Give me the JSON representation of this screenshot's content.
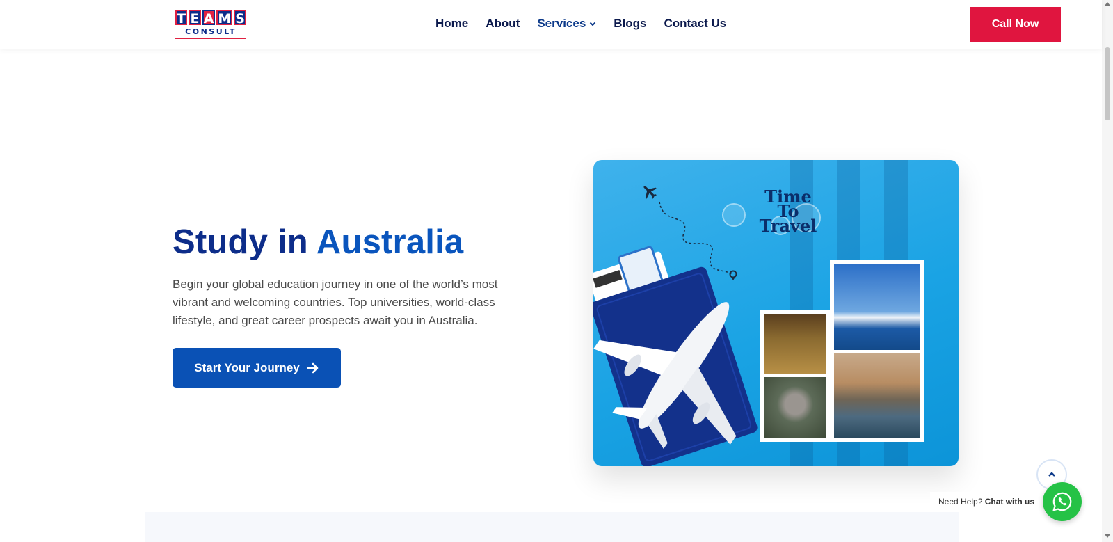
{
  "logo": {
    "letters": [
      "T",
      "E",
      "A",
      "M",
      "S"
    ],
    "sub": "CONSULT"
  },
  "nav": {
    "items": [
      {
        "label": "Home"
      },
      {
        "label": "About"
      },
      {
        "label": "Services"
      },
      {
        "label": "Blogs"
      },
      {
        "label": "Contact Us"
      }
    ]
  },
  "header": {
    "call_label": "Call Now"
  },
  "hero": {
    "title_main": "Study in",
    "title_accent": "Australia",
    "description": "Begin your global education journey in one of the world’s most vibrant and welcoming countries. Top universities, world-class lifestyle, and great career prospects await you in Australia.",
    "cta_label": "Start Your Journey"
  },
  "image": {
    "tagline_lines": [
      "Time",
      "To",
      "Travel"
    ]
  },
  "chat": {
    "prefix": "Need Help?",
    "link": "Chat with us"
  },
  "colors": {
    "brand_navy": "#0d2d8a",
    "brand_blue": "#0a51b5",
    "brand_red": "#e0153f",
    "whatsapp": "#25c246"
  }
}
